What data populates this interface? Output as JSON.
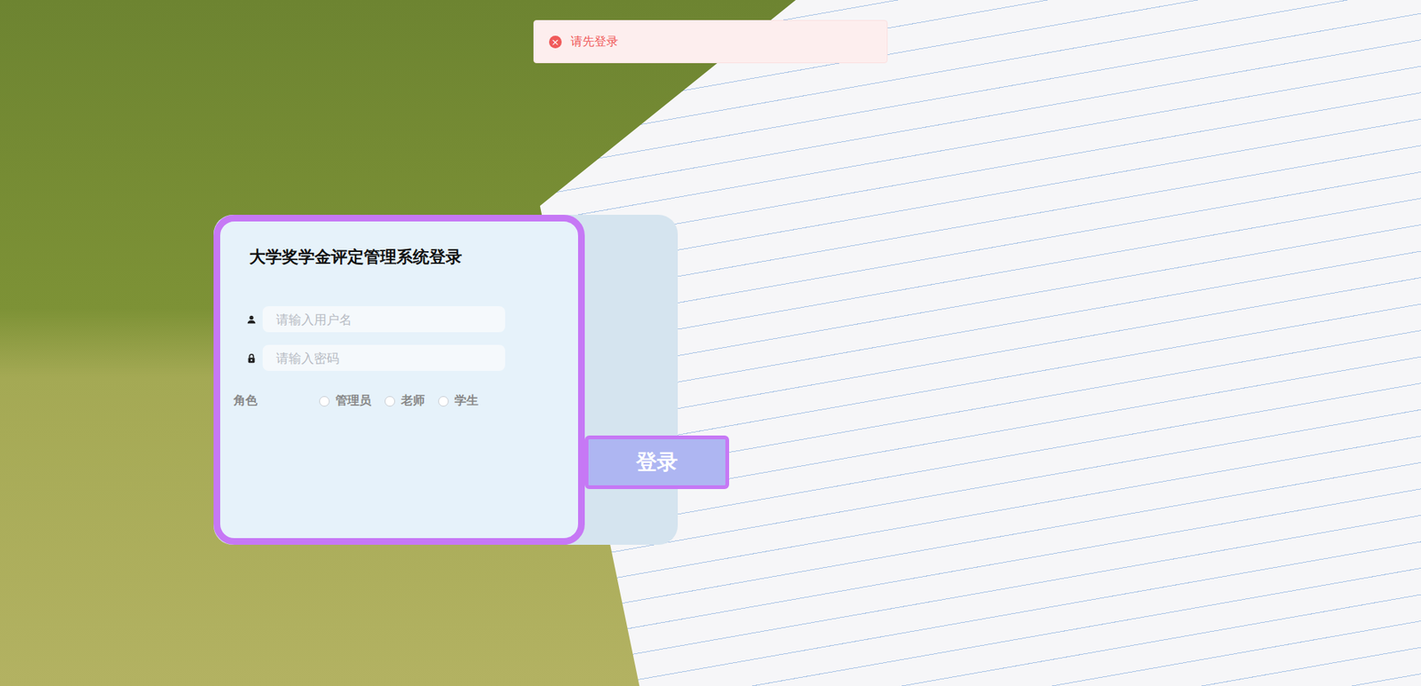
{
  "toast": {
    "icon": "×",
    "message": "请先登录"
  },
  "login": {
    "title": "大学奖学金评定管理系统登录",
    "username": {
      "placeholder": "请输入用户名"
    },
    "password": {
      "placeholder": "请输入密码"
    },
    "role": {
      "label": "角色",
      "options": [
        {
          "label": "管理员",
          "selected": false
        },
        {
          "label": "老师",
          "selected": false
        },
        {
          "label": "学生",
          "selected": false
        }
      ]
    },
    "button": "登录"
  }
}
